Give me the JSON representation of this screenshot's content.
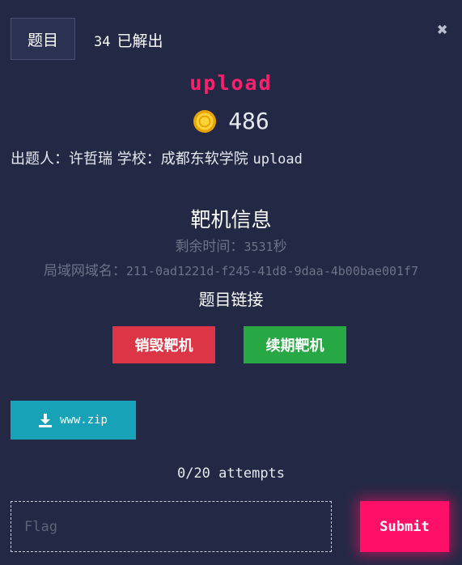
{
  "header": {
    "tab_label": "题目",
    "solves_count": "34",
    "solves_label": "已解出"
  },
  "challenge": {
    "name": "upload",
    "points": "486",
    "author_label": "出题人：",
    "author": "许哲瑞",
    "school_label": "学校：",
    "school": "成都东软学院",
    "category": "upload"
  },
  "target": {
    "section_title": "靶机信息",
    "remaining_label": "剩余时间：",
    "remaining_value": "3531",
    "remaining_unit": "秒",
    "domain_label": "局域网域名：",
    "domain_value": "211-0ad1221d-f245-41d8-9daa-4b00bae001f7",
    "link_label": "题目链接",
    "destroy_label": "销毁靶机",
    "renew_label": "续期靶机"
  },
  "files": {
    "download_label": "www.zip"
  },
  "submission": {
    "attempts": "0/20 attempts",
    "flag_placeholder": "Flag",
    "submit_label": "Submit"
  },
  "colors": {
    "background": "#232945",
    "title": "#ff1f6d",
    "destroy": "#dc3545",
    "renew": "#28a745",
    "download": "#17a2b8",
    "submit": "#ff1068"
  },
  "icons": {
    "close": "close-icon",
    "coin": "coin-icon",
    "download": "download-icon"
  }
}
